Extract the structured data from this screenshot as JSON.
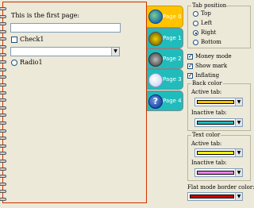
{
  "page": {
    "label": "This is the first page:",
    "textbox_value": "",
    "check1_label": "Check1",
    "combo_value": "",
    "radio1_label": "Radio1"
  },
  "tabs": [
    {
      "label": "Page 0",
      "color": "#ffc300",
      "icon": "globe-icon",
      "selected": true
    },
    {
      "label": "Page 1",
      "color": "#20bcbc",
      "icon": "gear-icon",
      "selected": false
    },
    {
      "label": "Page 2",
      "color": "#20bcbc",
      "icon": "disc-icon",
      "selected": false
    },
    {
      "label": "Page 3",
      "color": "#20bcbc",
      "icon": "ball-icon",
      "selected": false
    },
    {
      "label": "Page 4",
      "color": "#20bcbc",
      "icon": "help-icon",
      "selected": false
    }
  ],
  "tab_position": {
    "title": "Tab position",
    "options": [
      "Top",
      "Left",
      "Right",
      "Bottom"
    ],
    "selected": "Right"
  },
  "options": [
    {
      "label": "Money mode",
      "checked": true
    },
    {
      "label": "Show mark",
      "checked": true
    },
    {
      "label": "Inflating",
      "checked": true
    }
  ],
  "back_color": {
    "title": "Back color",
    "active_label": "Active tab:",
    "active_color": "#ffc300",
    "inactive_label": "Inactive tab:",
    "inactive_color": "#20bcbc"
  },
  "text_color": {
    "title": "Text color",
    "active_label": "Active tab:",
    "active_color": "#ffff00",
    "inactive_label": "Inactive tab:",
    "inactive_color": "#f080f0"
  },
  "flat_border": {
    "label": "Flat mode border color:",
    "color": "#cc0000"
  }
}
